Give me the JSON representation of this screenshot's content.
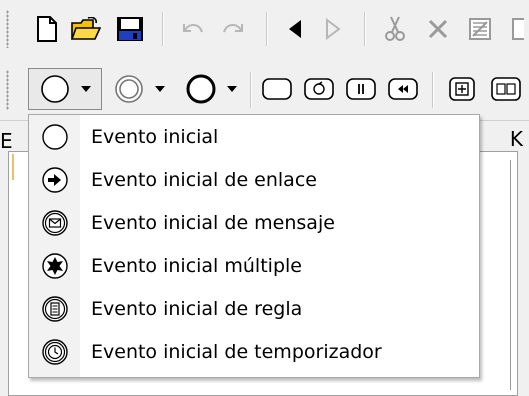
{
  "toolbar1": {
    "buttons": [
      {
        "name": "new-document-icon"
      },
      {
        "name": "open-folder-icon"
      },
      {
        "name": "save-icon"
      },
      {
        "name": "undo-icon"
      },
      {
        "name": "redo-icon"
      },
      {
        "name": "back-icon"
      },
      {
        "name": "forward-icon"
      },
      {
        "name": "cut-icon"
      },
      {
        "name": "delete-icon"
      },
      {
        "name": "export-icon"
      }
    ]
  },
  "toolbar2": {
    "buttons": [
      {
        "name": "start-event-icon"
      },
      {
        "name": "intermediate-event-icon"
      },
      {
        "name": "end-event-icon"
      },
      {
        "name": "task-icon"
      },
      {
        "name": "loop-task-icon"
      },
      {
        "name": "parallel-task-icon"
      },
      {
        "name": "compensation-task-icon"
      },
      {
        "name": "subprocess-icon"
      },
      {
        "name": "adhoc-subprocess-icon"
      }
    ]
  },
  "pane": {
    "label_fragment": "E",
    "close_fragment": "K"
  },
  "menu": {
    "items": [
      {
        "label": "Evento inicial",
        "icon": "start-event-icon"
      },
      {
        "label": "Evento inicial de enlace",
        "icon": "link-event-icon"
      },
      {
        "label": "Evento inicial de mensaje",
        "icon": "message-event-icon"
      },
      {
        "label": "Evento inicial múltiple",
        "icon": "multiple-event-icon"
      },
      {
        "label": "Evento inicial de regla",
        "icon": "rule-event-icon"
      },
      {
        "label": "Evento inicial de temporizador",
        "icon": "timer-event-icon"
      }
    ]
  },
  "colors": {
    "background": "#f0f0f0",
    "menu_background": "#ffffff",
    "menu_gutter": "#f2f2f2",
    "save_blue": "#1f3fbf",
    "folder_yellow": "#f2c200"
  }
}
